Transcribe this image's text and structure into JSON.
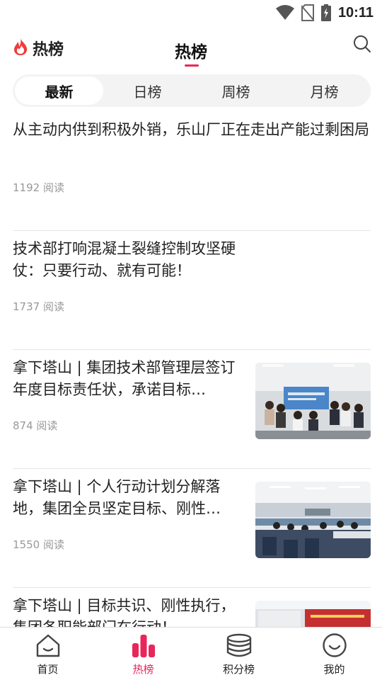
{
  "status_bar": {
    "time": "10:11",
    "icons": [
      "wifi-icon",
      "no-sim-icon",
      "battery-charging-icon"
    ]
  },
  "header": {
    "brand_label": "热榜",
    "brand_icon": "flame-icon",
    "title": "热榜",
    "search_icon": "search-icon"
  },
  "colors": {
    "accent": "#e8265a",
    "flame": "#f23a3a",
    "text": "#222222",
    "muted": "#999999",
    "tab_bg": "#f3f3f3"
  },
  "tabs": [
    {
      "label": "最新",
      "active": true
    },
    {
      "label": "日榜",
      "active": false
    },
    {
      "label": "周榜",
      "active": false
    },
    {
      "label": "月榜",
      "active": false
    }
  ],
  "articles": [
    {
      "title": "从主动内供到积极外销，乐山厂正在走出产能过剩困局",
      "reads": "1192 阅读",
      "has_image": false
    },
    {
      "title": "技术部打响混凝土裂缝控制攻坚硬仗：只要行动、就有可能！",
      "reads": "1737 阅读",
      "has_image": false
    },
    {
      "title": "拿下塔山 | 集团技术部管理层签订年度目标责任状，承诺目标…",
      "reads": "874 阅读",
      "has_image": true,
      "image": "group-photo"
    },
    {
      "title": "拿下塔山 | 个人行动计划分解落地，集团全员坚定目标、刚性…",
      "reads": "1550 阅读",
      "has_image": true,
      "image": "meeting-room-photo"
    },
    {
      "title": "拿下塔山 | 目标共识、刚性执行，集团各职能部门在行动！",
      "reads": "",
      "has_image": true,
      "image": "conference-banner-photo"
    }
  ],
  "bottom_nav": [
    {
      "label": "首页",
      "icon": "home-icon",
      "active": false
    },
    {
      "label": "热榜",
      "icon": "bar-chart-icon",
      "active": true
    },
    {
      "label": "积分榜",
      "icon": "coin-stack-icon",
      "active": false
    },
    {
      "label": "我的",
      "icon": "smile-icon",
      "active": false
    }
  ]
}
